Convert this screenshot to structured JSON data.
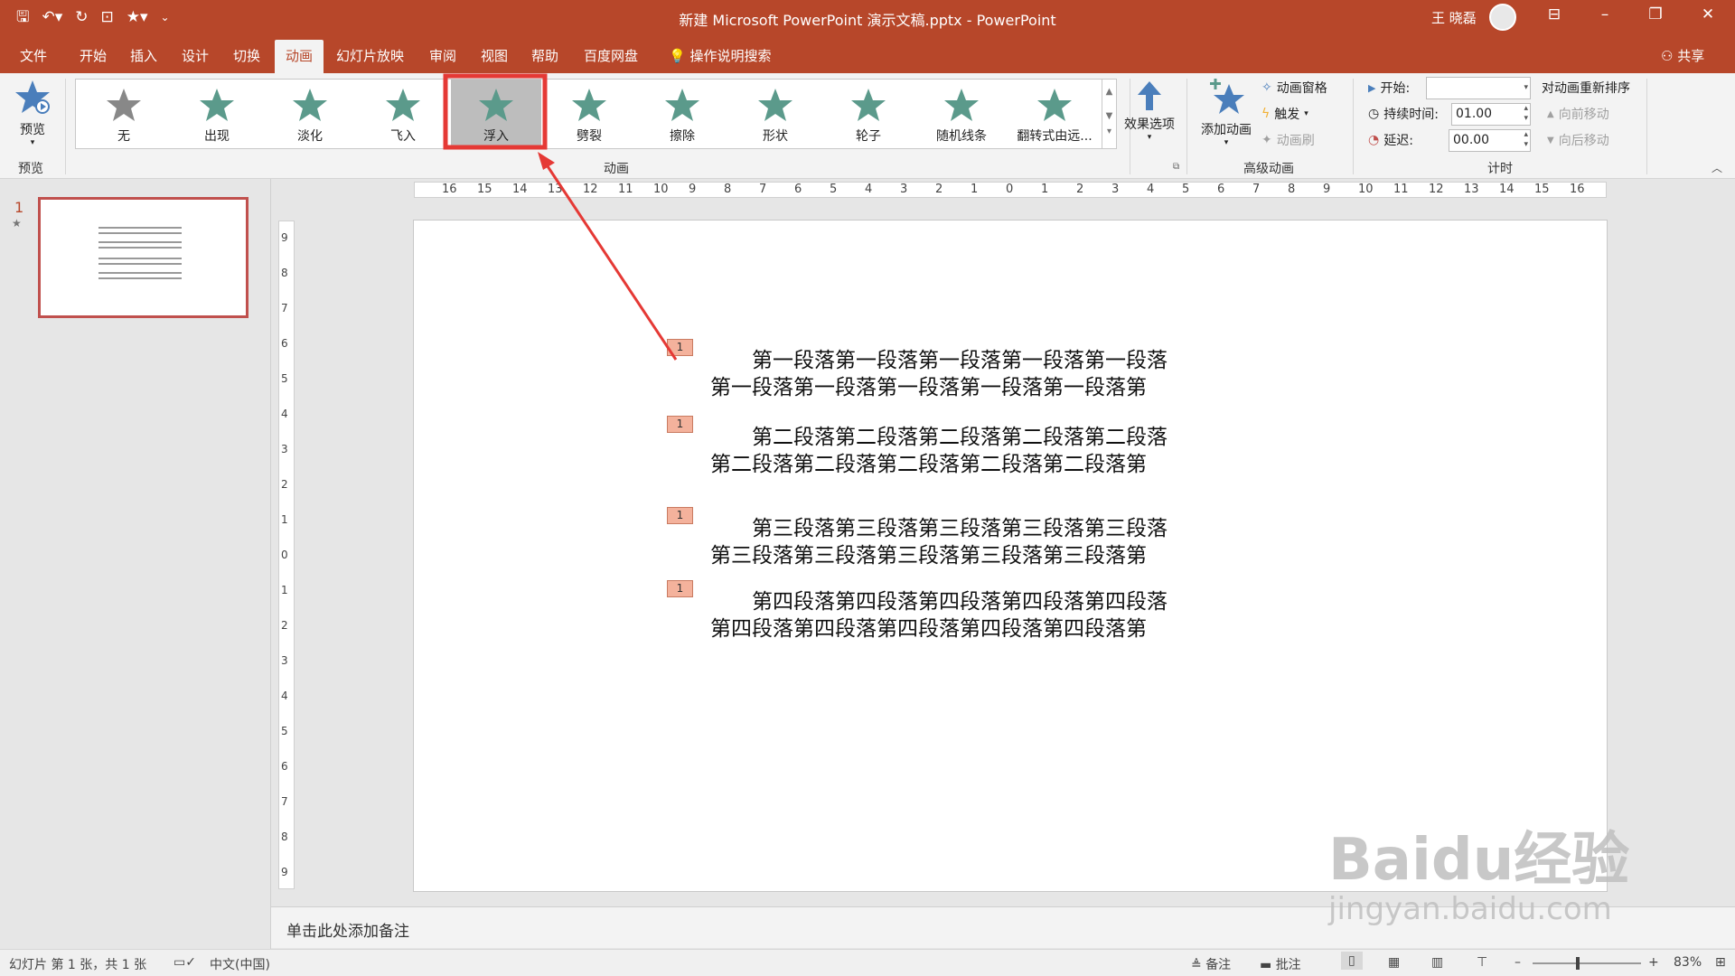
{
  "window": {
    "title": "新建 Microsoft PowerPoint 演示文稿.pptx  -  PowerPoint",
    "user": "王 晓磊"
  },
  "tabs": [
    "文件",
    "开始",
    "插入",
    "设计",
    "切换",
    "动画",
    "幻灯片放映",
    "审阅",
    "视图",
    "帮助",
    "百度网盘"
  ],
  "tabs_active": "动画",
  "search_label": "操作说明搜索",
  "share_label": "共享",
  "ribbon": {
    "preview_label": "预览",
    "preview_group": "预览",
    "animations_group": "动画",
    "animations": [
      "无",
      "出现",
      "淡化",
      "飞入",
      "浮入",
      "劈裂",
      "擦除",
      "形状",
      "轮子",
      "随机线条",
      "翻转式由远..."
    ],
    "selected_animation": "浮入",
    "effect_options": "效果选项",
    "add_animation": "添加动画",
    "animation_pane": "动画窗格",
    "trigger": "触发",
    "animation_painter": "动画刷",
    "advanced_group": "高级动画",
    "start_label": "开始:",
    "start_value": "",
    "duration_label": "持续时间:",
    "duration_value": "01.00",
    "delay_label": "延迟:",
    "delay_value": "00.00",
    "timing_group": "计时",
    "reorder_label": "对动画重新排序",
    "move_earlier": "向前移动",
    "move_later": "向后移动"
  },
  "thumbnail": {
    "number": "1",
    "marker": "★"
  },
  "slide": {
    "paragraphs": [
      {
        "marker": "1",
        "line1": "第一段落第一段落第一段落第一段落第一段落",
        "line2": "第一段落第一段落第一段落第一段落第一段落第"
      },
      {
        "marker": "1",
        "line1": "第二段落第二段落第二段落第二段落第二段落",
        "line2": "第二段落第二段落第二段落第二段落第二段落第"
      },
      {
        "marker": "1",
        "line1": "第三段落第三段落第三段落第三段落第三段落",
        "line2": "第三段落第三段落第三段落第三段落第三段落第"
      },
      {
        "marker": "1",
        "line1": "第四段落第四段落第四段落第四段落第四段落",
        "line2": "第四段落第四段落第四段落第四段落第四段落第"
      }
    ]
  },
  "notes_placeholder": "单击此处添加备注",
  "status": {
    "slide_info": "幻灯片 第 1 张，共 1 张",
    "language": "中文(中国)",
    "notes": "备注",
    "comments": "批注",
    "zoom": "83%"
  },
  "watermark": {
    "line1": "Baidu经验",
    "line2": "jingyan.baidu.com"
  },
  "colors": {
    "accent": "#b7472a",
    "star": "#5b9a8b",
    "selected_box": "#e53935",
    "marker": "#f4b29c"
  }
}
